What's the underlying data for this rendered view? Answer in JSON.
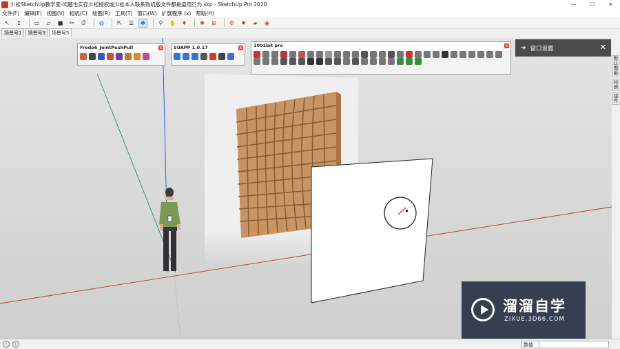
{
  "window": {
    "title": "少松SketchUp教学室-问题也实存少松授权成少松本人联系购机版文件都是盗用行为.skp - SketchUp Pro 2020",
    "controls": [
      "—",
      "☐",
      "✕"
    ]
  },
  "menu": [
    "文件(F)",
    "编辑(E)",
    "视图(V)",
    "相机(C)",
    "绘图(R)",
    "工具(T)",
    "窗口(W)",
    "扩展程序 (x)",
    "帮助(H)"
  ],
  "toolbar": {
    "icons": [
      "select-arrow-icon",
      "select-cursor-icon",
      "new-file-icon",
      "open-file-icon",
      "save-icon",
      "cut-icon",
      "print-icon",
      "model-info-icon",
      "walkthrough-icon",
      "orbit-icon",
      "pan-icon",
      "zoom-icon",
      "zoom-window-icon",
      "fire-icon",
      "house-icon",
      "component-icon",
      "extension-icon",
      "warehouse-icon",
      "ruby-icon"
    ]
  },
  "scene_tabs": [
    "场景号1",
    "场景号3",
    "场景号5"
  ],
  "float_toolbars": [
    {
      "title": "Fredo6_JointPushPull",
      "close": "x"
    },
    {
      "title": "SUAPP 1.0.17",
      "close": "x"
    },
    {
      "title": "1001bit pro",
      "close": "x"
    }
  ],
  "panel": {
    "arrow": "➔",
    "title": "窗口设置",
    "close": "✕"
  },
  "side_tabs": [
    "默认面板",
    "材质",
    "组件"
  ],
  "status": {
    "vcb_label": "数值",
    "vcb_value": ""
  },
  "watermark": {
    "name": "溜溜自学",
    "url": "ZIXUE.3D66.COM"
  },
  "colors": {
    "accent": "#cde4f7",
    "panel": "#4b4b4b",
    "shelf": "#c79463",
    "axis_red": "#c0392b",
    "axis_green": "#2e8b57",
    "axis_blue": "#2c4bd8"
  }
}
